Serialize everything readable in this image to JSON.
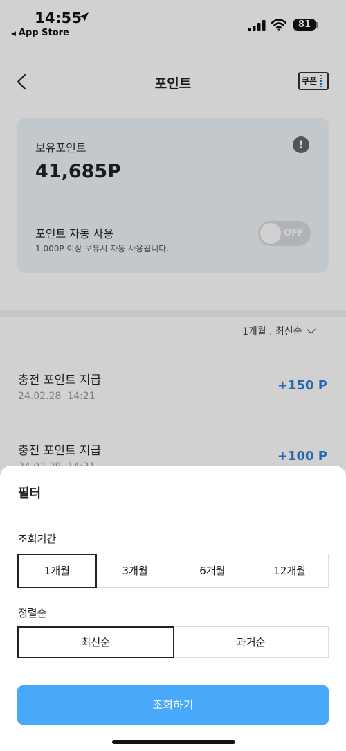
{
  "status_bar": {
    "time": "14:55",
    "back_app": "App Store",
    "battery": "81"
  },
  "header": {
    "title": "포인트",
    "coupon_label": "쿠폰"
  },
  "points_card": {
    "label": "보유포인트",
    "value": "41,685P",
    "auto_use_title": "포인트 자동 사용",
    "auto_use_desc": "1,000P 이상 보유시 자동 사용됩니다.",
    "toggle_label": "OFF"
  },
  "list": {
    "filter_summary": "1개월 . 최신순",
    "items": [
      {
        "title": "충전 포인트 지급",
        "date": "24.02.28",
        "time": "14:21",
        "amount": "+150 P"
      },
      {
        "title": "충전 포인트 지급",
        "date": "24.02.28",
        "time": "14:21",
        "amount": "+100 P"
      }
    ]
  },
  "filter_sheet": {
    "title": "필터",
    "period_label": "조회기간",
    "periods": [
      "1개월",
      "3개월",
      "6개월",
      "12개월"
    ],
    "selected_period": "1개월",
    "sort_label": "정렬순",
    "sorts": [
      "최신순",
      "과거순"
    ],
    "selected_sort": "최신순",
    "submit_label": "조회하기"
  },
  "colors": {
    "accent": "#48a9fa",
    "amount": "#2e7fd6",
    "card_bg": "#eef4fb"
  },
  "icons": [
    "location-arrow-icon",
    "signal-icon",
    "wifi-icon",
    "back-chevron-icon",
    "coupon-icon",
    "info-icon",
    "chevron-down-icon"
  ]
}
